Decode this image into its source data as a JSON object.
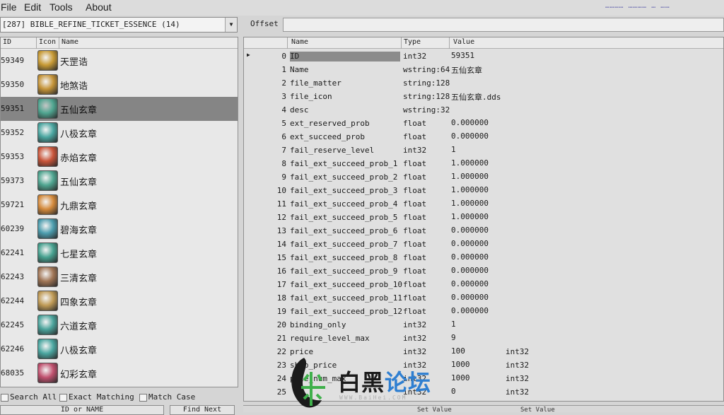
{
  "menu": [
    "File",
    "Edit",
    "Tools",
    "About"
  ],
  "top_right_text": "………… ………… … ……",
  "list_selector": "[287] BIBLE_REFINE_TICKET_ESSENCE (14)",
  "offset_label": "Offset",
  "offset_value": "",
  "left_columns": [
    "ID",
    "Icon",
    "Name"
  ],
  "items": [
    {
      "id": "59349",
      "name": "天罡诰",
      "icon_color": "#c79a35"
    },
    {
      "id": "59350",
      "name": "地煞诰",
      "icon_color": "#c59438"
    },
    {
      "id": "59351",
      "name": "五仙玄章",
      "icon_color": "#4fa590"
    },
    {
      "id": "59352",
      "name": "八极玄章",
      "icon_color": "#4aa6a0"
    },
    {
      "id": "59353",
      "name": "赤焰玄章",
      "icon_color": "#c9553a"
    },
    {
      "id": "59373",
      "name": "五仙玄章",
      "icon_color": "#4fa590"
    },
    {
      "id": "59721",
      "name": "九鼎玄章",
      "icon_color": "#d48a3c"
    },
    {
      "id": "60239",
      "name": "碧海玄章",
      "icon_color": "#4c9dae"
    },
    {
      "id": "62241",
      "name": "七星玄章",
      "icon_color": "#46a18f"
    },
    {
      "id": "62243",
      "name": "三清玄章",
      "icon_color": "#a07555"
    },
    {
      "id": "62244",
      "name": "四象玄章",
      "icon_color": "#bf9a55"
    },
    {
      "id": "62245",
      "name": "六道玄章",
      "icon_color": "#4aa39b"
    },
    {
      "id": "62246",
      "name": "八极玄章",
      "icon_color": "#4aa6a0"
    },
    {
      "id": "68035",
      "name": "幻彩玄章",
      "icon_color": "#c0506e"
    }
  ],
  "selected_item_index": 2,
  "search_options": [
    "Search All",
    "Exact Matching",
    "Match Case"
  ],
  "bottom_left_buttons": [
    "ID or NAME",
    "Find Next"
  ],
  "right_columns": [
    "Name",
    "Type",
    "Value"
  ],
  "properties": [
    {
      "idx": "0",
      "name": "ID",
      "type": "int32",
      "value": "59351"
    },
    {
      "idx": "1",
      "name": "Name",
      "type": "wstring:64",
      "value": "五仙玄章"
    },
    {
      "idx": "2",
      "name": "file_matter",
      "type": "string:128",
      "value": ""
    },
    {
      "idx": "3",
      "name": "file_icon",
      "type": "string:128",
      "value": "五仙玄章.dds"
    },
    {
      "idx": "4",
      "name": "desc",
      "type": "wstring:32",
      "value": ""
    },
    {
      "idx": "5",
      "name": "ext_reserved_prob",
      "type": "float",
      "value": "0.000000"
    },
    {
      "idx": "6",
      "name": "ext_succeed_prob",
      "type": "float",
      "value": "0.000000"
    },
    {
      "idx": "7",
      "name": "fail_reserve_level",
      "type": "int32",
      "value": "1"
    },
    {
      "idx": "8",
      "name": "fail_ext_succeed_prob_1",
      "type": "float",
      "value": "1.000000"
    },
    {
      "idx": "9",
      "name": "fail_ext_succeed_prob_2",
      "type": "float",
      "value": "1.000000"
    },
    {
      "idx": "10",
      "name": "fail_ext_succeed_prob_3",
      "type": "float",
      "value": "1.000000"
    },
    {
      "idx": "11",
      "name": "fail_ext_succeed_prob_4",
      "type": "float",
      "value": "1.000000"
    },
    {
      "idx": "12",
      "name": "fail_ext_succeed_prob_5",
      "type": "float",
      "value": "1.000000"
    },
    {
      "idx": "13",
      "name": "fail_ext_succeed_prob_6",
      "type": "float",
      "value": "0.000000"
    },
    {
      "idx": "14",
      "name": "fail_ext_succeed_prob_7",
      "type": "float",
      "value": "0.000000"
    },
    {
      "idx": "15",
      "name": "fail_ext_succeed_prob_8",
      "type": "float",
      "value": "0.000000"
    },
    {
      "idx": "16",
      "name": "fail_ext_succeed_prob_9",
      "type": "float",
      "value": "0.000000"
    },
    {
      "idx": "17",
      "name": "fail_ext_succeed_prob_10",
      "type": "float",
      "value": "0.000000"
    },
    {
      "idx": "18",
      "name": "fail_ext_succeed_prob_11",
      "type": "float",
      "value": "0.000000"
    },
    {
      "idx": "19",
      "name": "fail_ext_succeed_prob_12",
      "type": "float",
      "value": "0.000000"
    },
    {
      "idx": "20",
      "name": "binding_only",
      "type": "int32",
      "value": "1"
    },
    {
      "idx": "21",
      "name": "require_level_max",
      "type": "int32",
      "value": "9"
    },
    {
      "idx": "22",
      "name": "price",
      "type": "int32",
      "value": "100",
      "extra": "int32"
    },
    {
      "idx": "23",
      "name": "shop_price",
      "type": "int32",
      "value": "1000",
      "extra": "int32"
    },
    {
      "idx": "24",
      "name": "pile_num_max",
      "type": "int32",
      "value": "1000",
      "extra": "int32"
    },
    {
      "idx": "25",
      "name": "",
      "type": "int32",
      "value": "0",
      "extra": "int32"
    }
  ],
  "selected_property_index": 0,
  "set_value_labels": [
    "Set Value",
    "Set Value"
  ],
  "watermark": {
    "black": "白黑",
    "blue": "论坛",
    "sub": "WWW.BaiHei.COM"
  }
}
